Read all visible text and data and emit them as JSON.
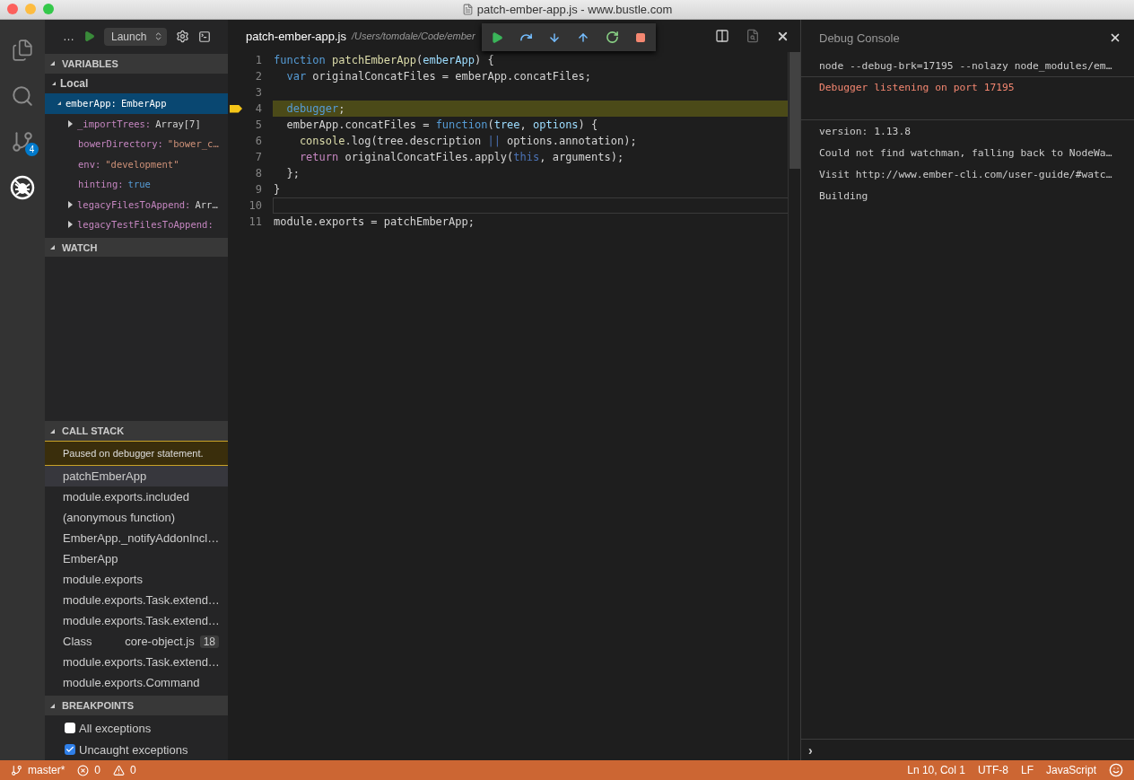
{
  "window": {
    "title": "patch-ember-app.js - www.bustle.com"
  },
  "activity_bar": [
    {
      "kind": "files",
      "selected": false
    },
    {
      "kind": "search",
      "selected": false
    },
    {
      "kind": "git",
      "selected": false,
      "badge": "4"
    },
    {
      "kind": "debug",
      "selected": true
    }
  ],
  "debug_header": {
    "title": "…",
    "config": "Launch"
  },
  "variables": {
    "title": "VARIABLES",
    "scopes": [
      {
        "label": "Local",
        "expanded": true,
        "children": [
          {
            "name": "emberApp:",
            "value": "EmberApp",
            "kind": "type",
            "expanded": true,
            "selected": true,
            "children": [
              {
                "name": "_importTrees:",
                "value": "Array[7]",
                "kind": "type",
                "expanded": false,
                "selected": false
              },
              {
                "name": "bowerDirectory:",
                "value": "\"bower_c…",
                "kind": "string",
                "selected": false
              },
              {
                "name": "env:",
                "value": "\"development\"",
                "kind": "string",
                "selected": false
              },
              {
                "name": "hinting:",
                "value": "true",
                "kind": "boolean",
                "selected": false
              },
              {
                "name": "legacyFilesToAppend:",
                "value": "Arr…",
                "kind": "type",
                "expanded": false,
                "selected": false
              },
              {
                "name": "legacyTestFilesToAppend:",
                "expanded": false,
                "selected": false
              }
            ]
          }
        ]
      }
    ]
  },
  "watch": {
    "title": "WATCH"
  },
  "call_stack": {
    "title": "CALL STACK",
    "status": "Paused on debugger statement.",
    "frames": [
      {
        "label": "patchEmberApp",
        "selected": true
      },
      {
        "label": "module.exports.included",
        "selected": false
      },
      {
        "label": "(anonymous function)",
        "selected": false
      },
      {
        "label": "EmberApp._notifyAddonIncl…",
        "selected": false
      },
      {
        "label": "EmberApp",
        "selected": false
      },
      {
        "label": "module.exports",
        "selected": false
      },
      {
        "label": "module.exports.Task.extend…",
        "selected": false
      },
      {
        "label": "module.exports.Task.extend…",
        "selected": false
      },
      {
        "label": "Class",
        "file": "core-object.js",
        "line": "18",
        "selected": false
      },
      {
        "label": "module.exports.Task.extend…",
        "selected": false
      },
      {
        "label": "module.exports.Command",
        "selected": false
      }
    ]
  },
  "breakpoints": {
    "title": "BREAKPOINTS",
    "items": [
      {
        "label": "All exceptions",
        "checked": false
      },
      {
        "label": "Uncaught exceptions",
        "checked": true
      }
    ]
  },
  "editor": {
    "tab": {
      "file": "patch-ember-app.js",
      "path": "/Users/tomdale/Code/ember"
    },
    "lines": [
      {
        "number": "1",
        "current": false,
        "cursor": false,
        "tokens": [
          {
            "t": "function ",
            "kind": "keyword"
          },
          {
            "t": "patchEmberApp",
            "kind": "fn"
          },
          {
            "t": "(",
            "kind": "plain"
          },
          {
            "t": "emberApp",
            "kind": "param"
          },
          {
            "t": ") {",
            "kind": "plain"
          }
        ]
      },
      {
        "number": "2",
        "current": false,
        "cursor": false,
        "tokens": [
          {
            "t": "  var",
            "kind": "keyword"
          },
          {
            "t": " originalConcatFiles = emberApp.concatFiles;",
            "kind": "plain"
          }
        ]
      },
      {
        "number": "3",
        "current": false,
        "cursor": false
      },
      {
        "number": "4",
        "current": true,
        "cursor": false,
        "tokens": [
          {
            "t": "  debugger",
            "kind": "keyword"
          },
          {
            "t": ";",
            "kind": "plain"
          }
        ]
      },
      {
        "number": "5",
        "current": false,
        "cursor": false,
        "tokens": [
          {
            "t": "  emberApp.concatFiles = ",
            "kind": "plain"
          },
          {
            "t": "function",
            "kind": "keyword"
          },
          {
            "t": "(",
            "kind": "plain"
          },
          {
            "t": "tree",
            "kind": "param"
          },
          {
            "t": ", ",
            "kind": "plain"
          },
          {
            "t": "options",
            "kind": "param"
          },
          {
            "t": ") {",
            "kind": "plain"
          }
        ]
      },
      {
        "number": "6",
        "current": false,
        "cursor": false,
        "tokens": [
          {
            "t": "    console",
            "kind": "fn"
          },
          {
            "t": ".log(tree.description ",
            "kind": "plain"
          },
          {
            "t": "||",
            "kind": "op"
          },
          {
            "t": " options.annotation);",
            "kind": "plain"
          }
        ]
      },
      {
        "number": "7",
        "current": false,
        "cursor": false,
        "tokens": [
          {
            "t": "    return",
            "kind": "control"
          },
          {
            "t": " originalConcatFiles.apply(",
            "kind": "plain"
          },
          {
            "t": "this",
            "kind": "this"
          },
          {
            "t": ", arguments);",
            "kind": "plain"
          }
        ]
      },
      {
        "number": "8",
        "current": false,
        "cursor": false,
        "tokens": [
          {
            "t": "  };",
            "kind": "plain"
          }
        ]
      },
      {
        "number": "9",
        "current": false,
        "cursor": false,
        "tokens": [
          {
            "t": "}",
            "kind": "plain"
          }
        ]
      },
      {
        "number": "10",
        "current": false,
        "cursor": true
      },
      {
        "number": "11",
        "current": false,
        "cursor": false,
        "tokens": [
          {
            "t": "module.exports = patchEmberApp;",
            "kind": "plain"
          }
        ]
      }
    ]
  },
  "debug_toolbar": [
    {
      "kind": "continue"
    },
    {
      "kind": "step-over"
    },
    {
      "kind": "step-into"
    },
    {
      "kind": "step-out"
    },
    {
      "kind": "restart"
    },
    {
      "kind": "stop"
    }
  ],
  "console": {
    "title": "Debug Console",
    "lines": [
      {
        "text": "node --debug-brk=17195 --nolazy node_modules/em…",
        "kind": "command"
      },
      {
        "text": "Debugger listening on port 17195",
        "kind": "error"
      },
      {
        "text": "version: 1.13.8",
        "kind": "output"
      },
      {
        "text": "Could not find watchman, falling back to NodeWa…",
        "kind": "output"
      },
      {
        "text": "Visit http://www.ember-cli.com/user-guide/#watc…",
        "kind": "output"
      },
      {
        "text": "Building",
        "kind": "output"
      }
    ],
    "prompt": "›"
  },
  "status_bar": {
    "branch": "master*",
    "errors": "0",
    "warnings": "0",
    "position": "Ln 10, Col 1",
    "encoding": "UTF-8",
    "eol": "LF",
    "language": "JavaScript"
  }
}
